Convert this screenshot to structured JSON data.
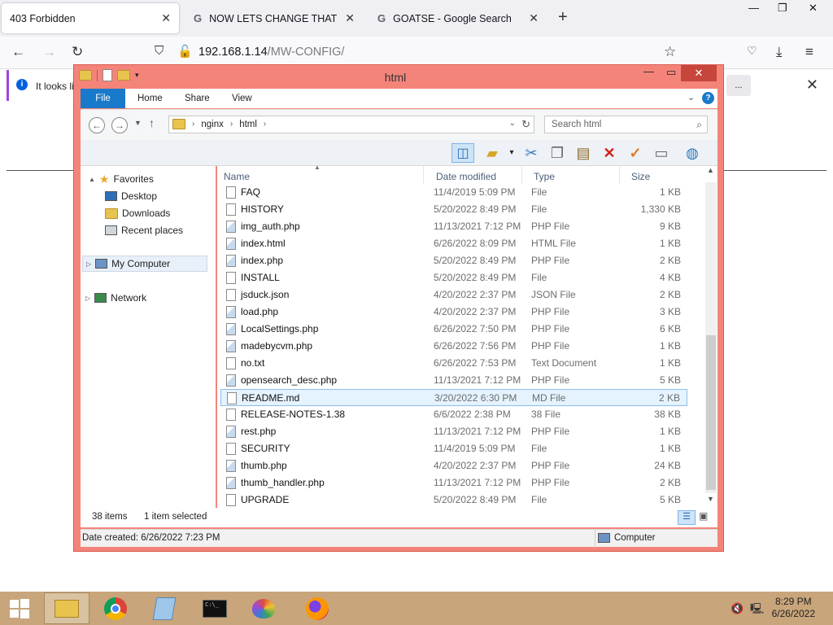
{
  "browser": {
    "tabs": [
      {
        "title": "403 Forbidden",
        "active": true,
        "favicon": ""
      },
      {
        "title": "NOW LETS CHANGE THAT BG",
        "active": false,
        "favicon": "G"
      },
      {
        "title": "GOATSE - Google Search",
        "active": false,
        "favicon": "G"
      }
    ],
    "url_host": "192.168.1.14",
    "url_path": "/MW-CONFIG/",
    "infobar_message": "It looks li",
    "infobar_button": "..."
  },
  "explorer": {
    "title": "html",
    "ribbon_tabs": [
      "File",
      "Home",
      "Share",
      "View"
    ],
    "breadcrumb": [
      "nginx",
      "html"
    ],
    "search_placeholder": "Search html",
    "nav": {
      "favorites": "Favorites",
      "desktop": "Desktop",
      "downloads": "Downloads",
      "recent": "Recent places",
      "computer": "My Computer",
      "network": "Network"
    },
    "columns": {
      "name": "Name",
      "date": "Date modified",
      "type": "Type",
      "size": "Size"
    },
    "files": [
      {
        "name": "FAQ",
        "date": "11/4/2019 5:09 PM",
        "type": "File",
        "size": "1 KB",
        "icon": "doc"
      },
      {
        "name": "HISTORY",
        "date": "5/20/2022 8:49 PM",
        "type": "File",
        "size": "1,330 KB",
        "icon": "doc"
      },
      {
        "name": "img_auth.php",
        "date": "11/13/2021 7:12 PM",
        "type": "PHP File",
        "size": "9 KB",
        "icon": "php"
      },
      {
        "name": "index.html",
        "date": "6/26/2022 8:09 PM",
        "type": "HTML File",
        "size": "1 KB",
        "icon": "php"
      },
      {
        "name": "index.php",
        "date": "5/20/2022 8:49 PM",
        "type": "PHP File",
        "size": "2 KB",
        "icon": "php"
      },
      {
        "name": "INSTALL",
        "date": "5/20/2022 8:49 PM",
        "type": "File",
        "size": "4 KB",
        "icon": "doc"
      },
      {
        "name": "jsduck.json",
        "date": "4/20/2022 2:37 PM",
        "type": "JSON File",
        "size": "2 KB",
        "icon": "doc"
      },
      {
        "name": "load.php",
        "date": "4/20/2022 2:37 PM",
        "type": "PHP File",
        "size": "3 KB",
        "icon": "php"
      },
      {
        "name": "LocalSettings.php",
        "date": "6/26/2022 7:50 PM",
        "type": "PHP File",
        "size": "6 KB",
        "icon": "php"
      },
      {
        "name": "madebycvm.php",
        "date": "6/26/2022 7:56 PM",
        "type": "PHP File",
        "size": "1 KB",
        "icon": "php"
      },
      {
        "name": "no.txt",
        "date": "6/26/2022 7:53 PM",
        "type": "Text Document",
        "size": "1 KB",
        "icon": "doc"
      },
      {
        "name": "opensearch_desc.php",
        "date": "11/13/2021 7:12 PM",
        "type": "PHP File",
        "size": "5 KB",
        "icon": "php"
      },
      {
        "name": "README.md",
        "date": "3/20/2022 6:30 PM",
        "type": "MD File",
        "size": "2 KB",
        "icon": "doc",
        "selected": true
      },
      {
        "name": "RELEASE-NOTES-1.38",
        "date": "6/6/2022 2:38 PM",
        "type": "38 File",
        "size": "38 KB",
        "icon": "doc"
      },
      {
        "name": "rest.php",
        "date": "11/13/2021 7:12 PM",
        "type": "PHP File",
        "size": "1 KB",
        "icon": "php"
      },
      {
        "name": "SECURITY",
        "date": "11/4/2019 5:09 PM",
        "type": "File",
        "size": "1 KB",
        "icon": "doc"
      },
      {
        "name": "thumb.php",
        "date": "4/20/2022 2:37 PM",
        "type": "PHP File",
        "size": "24 KB",
        "icon": "php"
      },
      {
        "name": "thumb_handler.php",
        "date": "11/13/2021 7:12 PM",
        "type": "PHP File",
        "size": "2 KB",
        "icon": "php"
      },
      {
        "name": "UPGRADE",
        "date": "5/20/2022 8:49 PM",
        "type": "File",
        "size": "5 KB",
        "icon": "doc"
      }
    ],
    "status_count": "38 items",
    "status_selected": "1 item selected",
    "details_created": "Date created: 6/26/2022 7:23 PM",
    "details_location": "Computer"
  },
  "taskbar": {
    "time": "8:29 PM",
    "date": "6/26/2022"
  },
  "colors": {
    "explorer_frame": "#f4847a",
    "ribbon_file": "#1979ca",
    "taskbar": "#c8a57a"
  }
}
